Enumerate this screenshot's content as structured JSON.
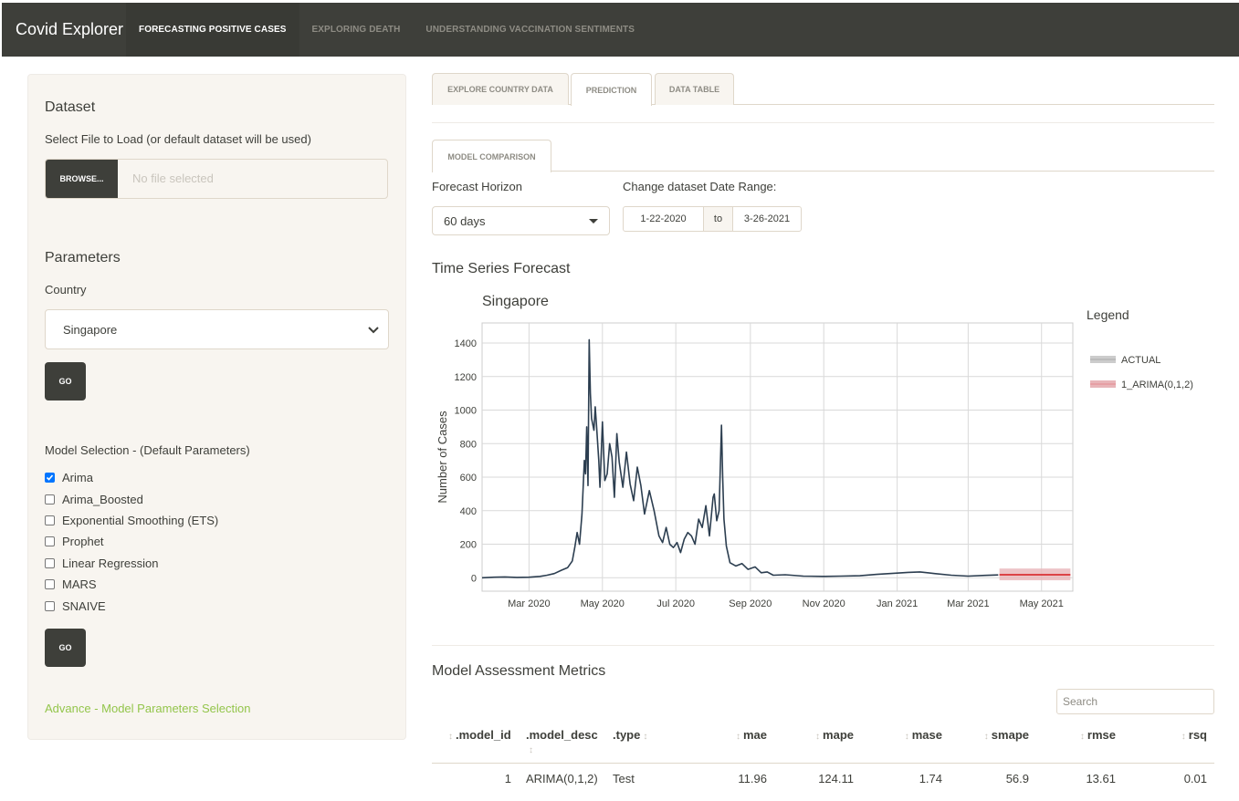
{
  "navbar": {
    "brand": "Covid Explorer",
    "items": [
      {
        "label": "FORECASTING POSITIVE CASES",
        "active": true
      },
      {
        "label": "EXPLORING DEATH",
        "active": false
      },
      {
        "label": "UNDERSTANDING VACCINATION SENTIMENTS",
        "active": false
      }
    ]
  },
  "sidebar": {
    "dataset_heading": "Dataset",
    "file_label": "Select File to Load (or default dataset will be used)",
    "browse_label": "BROWSE...",
    "file_placeholder": "No file selected",
    "parameters_heading": "Parameters",
    "country_label": "Country",
    "country_value": "Singapore",
    "go_label": "GO",
    "model_selection_label": "Model Selection - (Default Parameters)",
    "models": [
      {
        "label": "Arima",
        "checked": true
      },
      {
        "label": "Arima_Boosted",
        "checked": false
      },
      {
        "label": "Exponential Smoothing (ETS)",
        "checked": false
      },
      {
        "label": "Prophet",
        "checked": false
      },
      {
        "label": "Linear Regression",
        "checked": false
      },
      {
        "label": "MARS",
        "checked": false
      },
      {
        "label": "SNAIVE",
        "checked": false
      }
    ],
    "advance_link": "Advance - Model Parameters Selection"
  },
  "main": {
    "tabs": [
      {
        "label": "EXPLORE COUNTRY DATA",
        "active": false
      },
      {
        "label": "PREDICTION",
        "active": true
      },
      {
        "label": "DATA TABLE",
        "active": false
      }
    ],
    "subtab": "MODEL COMPARISON",
    "horizon_label": "Forecast Horizon",
    "horizon_value": "60 days",
    "daterange_label": "Change dataset Date Range:",
    "date_start": "1-22-2020",
    "date_sep": "to",
    "date_end": "3-26-2021",
    "forecast_title": "Time Series Forecast",
    "metrics_title": "Model Assessment Metrics",
    "search_placeholder": "Search"
  },
  "chart_data": {
    "type": "line",
    "title": "Singapore",
    "ylabel": "Number of Cases",
    "xlabel": "",
    "ylim": [
      -80,
      1520
    ],
    "yticks": [
      0,
      200,
      400,
      600,
      800,
      1000,
      1200,
      1400
    ],
    "xlim": [
      "2020-01-22",
      "2021-05-27"
    ],
    "xticks": [
      {
        "date": "2020-03-01",
        "label": "Mar 2020"
      },
      {
        "date": "2020-05-01",
        "label": "May 2020"
      },
      {
        "date": "2020-07-01",
        "label": "Jul 2020"
      },
      {
        "date": "2020-09-01",
        "label": "Sep 2020"
      },
      {
        "date": "2020-11-01",
        "label": "Nov 2020"
      },
      {
        "date": "2021-01-01",
        "label": "Jan 2021"
      },
      {
        "date": "2021-03-01",
        "label": "Mar 2021"
      },
      {
        "date": "2021-05-01",
        "label": "May 2021"
      }
    ],
    "legend_title": "Legend",
    "legend_position": "right",
    "grid": true,
    "series": [
      {
        "name": "ACTUAL",
        "color": "#2c3e50",
        "points": [
          [
            "2020-01-22",
            0
          ],
          [
            "2020-02-01",
            3
          ],
          [
            "2020-02-10",
            5
          ],
          [
            "2020-02-20",
            2
          ],
          [
            "2020-03-01",
            3
          ],
          [
            "2020-03-10",
            8
          ],
          [
            "2020-03-16",
            15
          ],
          [
            "2020-03-22",
            25
          ],
          [
            "2020-03-28",
            45
          ],
          [
            "2020-04-02",
            60
          ],
          [
            "2020-04-06",
            100
          ],
          [
            "2020-04-08",
            180
          ],
          [
            "2020-04-10",
            270
          ],
          [
            "2020-04-12",
            200
          ],
          [
            "2020-04-14",
            380
          ],
          [
            "2020-04-16",
            700
          ],
          [
            "2020-04-17",
            620
          ],
          [
            "2020-04-18",
            900
          ],
          [
            "2020-04-19",
            550
          ],
          [
            "2020-04-20",
            1420
          ],
          [
            "2020-04-21",
            1100
          ],
          [
            "2020-04-22",
            950
          ],
          [
            "2020-04-24",
            880
          ],
          [
            "2020-04-25",
            1020
          ],
          [
            "2020-04-26",
            920
          ],
          [
            "2020-04-28",
            700
          ],
          [
            "2020-04-29",
            540
          ],
          [
            "2020-05-01",
            930
          ],
          [
            "2020-05-03",
            580
          ],
          [
            "2020-05-05",
            620
          ],
          [
            "2020-05-07",
            800
          ],
          [
            "2020-05-09",
            720
          ],
          [
            "2020-05-11",
            480
          ],
          [
            "2020-05-13",
            860
          ],
          [
            "2020-05-15",
            690
          ],
          [
            "2020-05-18",
            540
          ],
          [
            "2020-05-21",
            750
          ],
          [
            "2020-05-24",
            560
          ],
          [
            "2020-05-27",
            460
          ],
          [
            "2020-05-30",
            660
          ],
          [
            "2020-06-02",
            550
          ],
          [
            "2020-06-05",
            380
          ],
          [
            "2020-06-09",
            520
          ],
          [
            "2020-06-13",
            400
          ],
          [
            "2020-06-17",
            250
          ],
          [
            "2020-06-20",
            210
          ],
          [
            "2020-06-23",
            300
          ],
          [
            "2020-06-26",
            200
          ],
          [
            "2020-06-29",
            180
          ],
          [
            "2020-07-02",
            210
          ],
          [
            "2020-07-05",
            150
          ],
          [
            "2020-07-08",
            230
          ],
          [
            "2020-07-11",
            270
          ],
          [
            "2020-07-14",
            250
          ],
          [
            "2020-07-17",
            200
          ],
          [
            "2020-07-20",
            350
          ],
          [
            "2020-07-23",
            300
          ],
          [
            "2020-07-26",
            430
          ],
          [
            "2020-07-29",
            250
          ],
          [
            "2020-08-01",
            480
          ],
          [
            "2020-08-02",
            500
          ],
          [
            "2020-08-04",
            340
          ],
          [
            "2020-08-06",
            400
          ],
          [
            "2020-08-08",
            910
          ],
          [
            "2020-08-09",
            600
          ],
          [
            "2020-08-10",
            350
          ],
          [
            "2020-08-12",
            190
          ],
          [
            "2020-08-15",
            90
          ],
          [
            "2020-08-20",
            70
          ],
          [
            "2020-08-25",
            85
          ],
          [
            "2020-08-30",
            50
          ],
          [
            "2020-09-05",
            65
          ],
          [
            "2020-09-10",
            30
          ],
          [
            "2020-09-15",
            35
          ],
          [
            "2020-09-20",
            15
          ],
          [
            "2020-09-30",
            18
          ],
          [
            "2020-10-15",
            10
          ],
          [
            "2020-11-01",
            8
          ],
          [
            "2020-11-15",
            10
          ],
          [
            "2020-12-01",
            12
          ],
          [
            "2020-12-15",
            20
          ],
          [
            "2021-01-01",
            28
          ],
          [
            "2021-01-10",
            32
          ],
          [
            "2021-01-20",
            35
          ],
          [
            "2021-02-01",
            25
          ],
          [
            "2021-02-15",
            15
          ],
          [
            "2021-03-01",
            10
          ],
          [
            "2021-03-15",
            14
          ],
          [
            "2021-03-26",
            17
          ]
        ]
      },
      {
        "name": "1_ARIMA(0,1,2)",
        "color": "#d7191c",
        "band_color": "#e8b4b8",
        "points": [
          [
            "2021-03-27",
            18
          ],
          [
            "2021-05-25",
            18
          ]
        ],
        "band_lower": -15,
        "band_upper": 55
      }
    ]
  },
  "metrics_table": {
    "columns": [
      ".model_id",
      ".model_desc",
      ".type",
      "mae",
      "mape",
      "mase",
      "smape",
      "rmse",
      "rsq"
    ],
    "rows": [
      [
        "1",
        "ARIMA(0,1,2)",
        "Test",
        "11.96",
        "124.11",
        "1.74",
        "56.9",
        "13.61",
        "0.01"
      ]
    ]
  }
}
